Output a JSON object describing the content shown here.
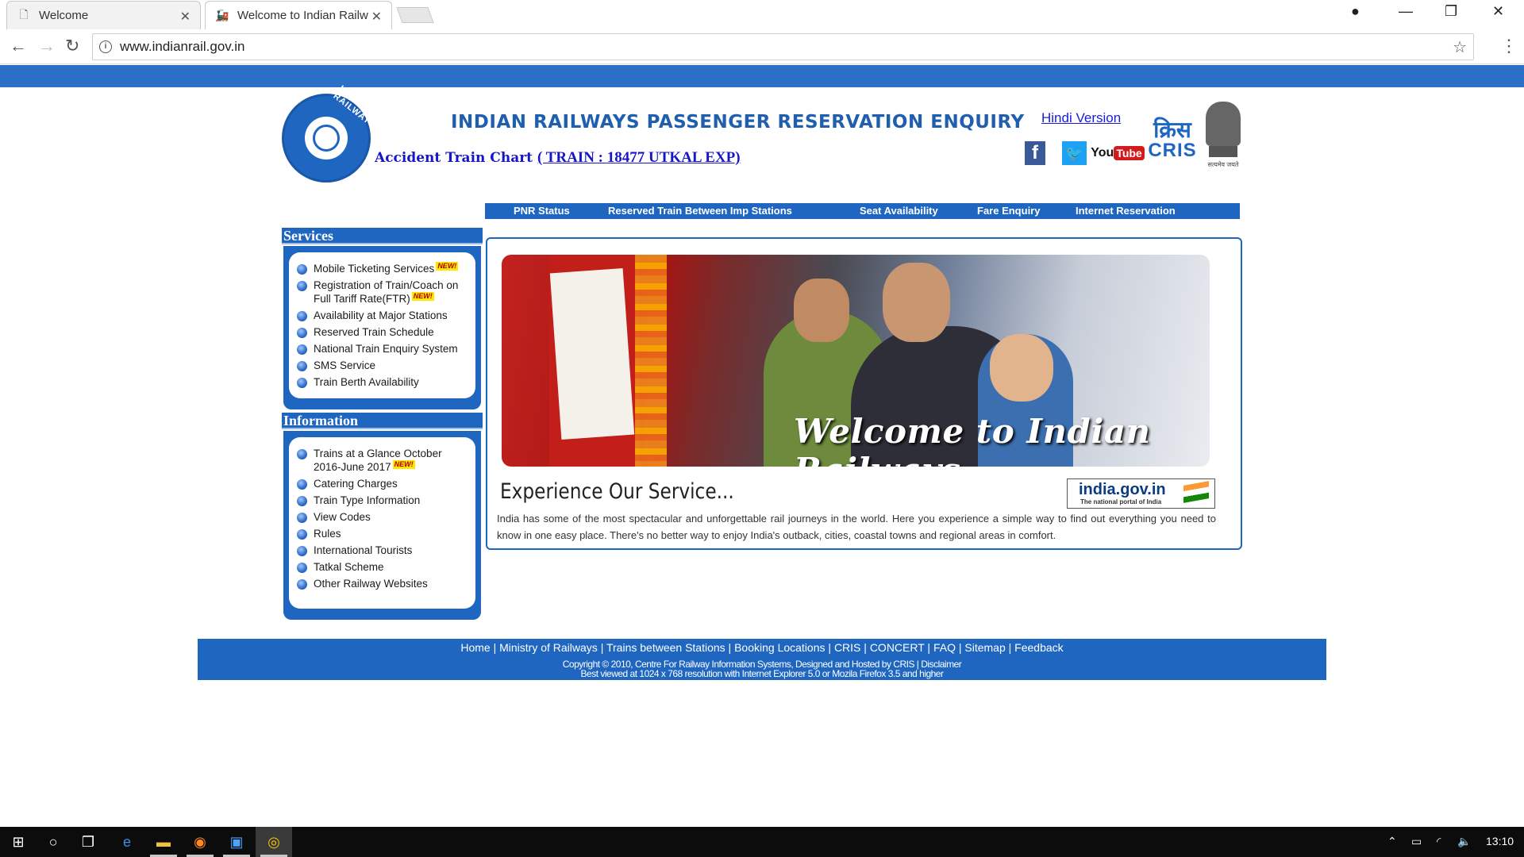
{
  "browser": {
    "tabs": [
      {
        "label": "Welcome",
        "active": false
      },
      {
        "label": "Welcome to Indian Railw",
        "active": true
      }
    ],
    "url": "www.indianrail.gov.in"
  },
  "header": {
    "title": "INDIAN RAILWAYS PASSENGER RESERVATION ENQUIRY",
    "hindi_link": "Hindi Version",
    "accident_label": "Accident Train Chart",
    "accident_train": "( TRAIN : 18477 UTKAL EXP)",
    "logo_ring_text": "INDIAN RAILWAYS",
    "cris_hindi": "क्रिस",
    "cris_en": "CRIS",
    "emblem_motto": "सत्यमेव जयते",
    "social": {
      "facebook": "f",
      "youtube_you": "You",
      "youtube_tube": "Tube"
    }
  },
  "menu": [
    "PNR Status",
    "Reserved Train Between Imp Stations",
    "Seat Availability",
    "Fare Enquiry",
    "Internet Reservation"
  ],
  "sidebar": {
    "services_title": "Services",
    "services": [
      {
        "label": "Mobile Ticketing Services",
        "new": "NEW!"
      },
      {
        "label": "Registration of Train/Coach on Full Tariff Rate(FTR)",
        "new": "NEW!"
      },
      {
        "label": "Availability at Major Stations",
        "new": ""
      },
      {
        "label": "Reserved Train Schedule",
        "new": ""
      },
      {
        "label": "National Train Enquiry System",
        "new": ""
      },
      {
        "label": "SMS Service",
        "new": ""
      },
      {
        "label": "Train Berth Availability",
        "new": ""
      }
    ],
    "information_title": "Information",
    "information": [
      {
        "label": "Trains at a Glance October 2016-June 2017",
        "new": "NEW!"
      },
      {
        "label": "Catering Charges",
        "new": ""
      },
      {
        "label": "Train Type Information",
        "new": ""
      },
      {
        "label": "View Codes",
        "new": ""
      },
      {
        "label": "Rules",
        "new": ""
      },
      {
        "label": "International Tourists",
        "new": ""
      },
      {
        "label": "Tatkal Scheme",
        "new": ""
      },
      {
        "label": "Other Railway Websites",
        "new": ""
      }
    ]
  },
  "content": {
    "banner_text": "Welcome to Indian Railways...",
    "experience_title": "Experience Our Service...",
    "indiagov_title": "india.gov.in",
    "indiagov_sub": "The national portal of India",
    "description": "India has some of the most spectacular and unforgettable rail journeys in the world. Here you experience a simple way to find out everything you need to know in one easy place. There's no better way to enjoy India's outback, cities, coastal towns and regional areas in comfort."
  },
  "footer": {
    "links": [
      "Home",
      "Ministry of Railways",
      "Trains between Stations",
      "Booking Locations",
      "CRIS",
      "CONCERT",
      "FAQ",
      "Sitemap",
      "Feedback"
    ],
    "copyright": "Copyright © 2010, Centre For Railway Information Systems, Designed and Hosted by CRIS | Disclaimer",
    "best_viewed": "Best viewed at 1024 x 768 resolution with Internet Explorer 5.0 or Mozila Firefox 3.5 and higher"
  },
  "taskbar": {
    "time": "13:10"
  },
  "colors": {
    "brand_blue": "#1f66c1",
    "top_bar": "#2b6fc7",
    "link": "#1b1bd6"
  }
}
